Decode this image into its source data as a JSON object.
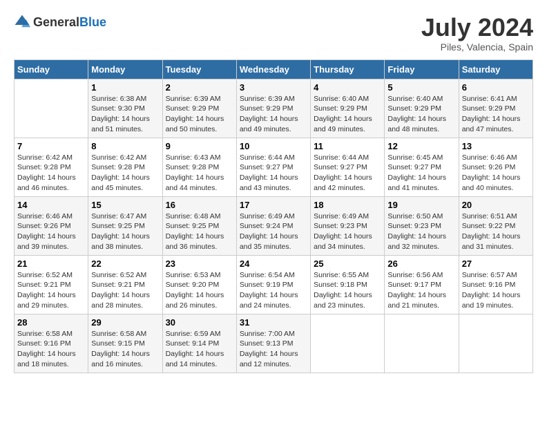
{
  "logo": {
    "general": "General",
    "blue": "Blue"
  },
  "title": "July 2024",
  "subtitle": "Piles, Valencia, Spain",
  "days_header": [
    "Sunday",
    "Monday",
    "Tuesday",
    "Wednesday",
    "Thursday",
    "Friday",
    "Saturday"
  ],
  "weeks": [
    [
      {
        "num": "",
        "info": ""
      },
      {
        "num": "1",
        "info": "Sunrise: 6:38 AM\nSunset: 9:30 PM\nDaylight: 14 hours\nand 51 minutes."
      },
      {
        "num": "2",
        "info": "Sunrise: 6:39 AM\nSunset: 9:29 PM\nDaylight: 14 hours\nand 50 minutes."
      },
      {
        "num": "3",
        "info": "Sunrise: 6:39 AM\nSunset: 9:29 PM\nDaylight: 14 hours\nand 49 minutes."
      },
      {
        "num": "4",
        "info": "Sunrise: 6:40 AM\nSunset: 9:29 PM\nDaylight: 14 hours\nand 49 minutes."
      },
      {
        "num": "5",
        "info": "Sunrise: 6:40 AM\nSunset: 9:29 PM\nDaylight: 14 hours\nand 48 minutes."
      },
      {
        "num": "6",
        "info": "Sunrise: 6:41 AM\nSunset: 9:29 PM\nDaylight: 14 hours\nand 47 minutes."
      }
    ],
    [
      {
        "num": "7",
        "info": "Sunrise: 6:42 AM\nSunset: 9:28 PM\nDaylight: 14 hours\nand 46 minutes."
      },
      {
        "num": "8",
        "info": "Sunrise: 6:42 AM\nSunset: 9:28 PM\nDaylight: 14 hours\nand 45 minutes."
      },
      {
        "num": "9",
        "info": "Sunrise: 6:43 AM\nSunset: 9:28 PM\nDaylight: 14 hours\nand 44 minutes."
      },
      {
        "num": "10",
        "info": "Sunrise: 6:44 AM\nSunset: 9:27 PM\nDaylight: 14 hours\nand 43 minutes."
      },
      {
        "num": "11",
        "info": "Sunrise: 6:44 AM\nSunset: 9:27 PM\nDaylight: 14 hours\nand 42 minutes."
      },
      {
        "num": "12",
        "info": "Sunrise: 6:45 AM\nSunset: 9:27 PM\nDaylight: 14 hours\nand 41 minutes."
      },
      {
        "num": "13",
        "info": "Sunrise: 6:46 AM\nSunset: 9:26 PM\nDaylight: 14 hours\nand 40 minutes."
      }
    ],
    [
      {
        "num": "14",
        "info": "Sunrise: 6:46 AM\nSunset: 9:26 PM\nDaylight: 14 hours\nand 39 minutes."
      },
      {
        "num": "15",
        "info": "Sunrise: 6:47 AM\nSunset: 9:25 PM\nDaylight: 14 hours\nand 38 minutes."
      },
      {
        "num": "16",
        "info": "Sunrise: 6:48 AM\nSunset: 9:25 PM\nDaylight: 14 hours\nand 36 minutes."
      },
      {
        "num": "17",
        "info": "Sunrise: 6:49 AM\nSunset: 9:24 PM\nDaylight: 14 hours\nand 35 minutes."
      },
      {
        "num": "18",
        "info": "Sunrise: 6:49 AM\nSunset: 9:23 PM\nDaylight: 14 hours\nand 34 minutes."
      },
      {
        "num": "19",
        "info": "Sunrise: 6:50 AM\nSunset: 9:23 PM\nDaylight: 14 hours\nand 32 minutes."
      },
      {
        "num": "20",
        "info": "Sunrise: 6:51 AM\nSunset: 9:22 PM\nDaylight: 14 hours\nand 31 minutes."
      }
    ],
    [
      {
        "num": "21",
        "info": "Sunrise: 6:52 AM\nSunset: 9:21 PM\nDaylight: 14 hours\nand 29 minutes."
      },
      {
        "num": "22",
        "info": "Sunrise: 6:52 AM\nSunset: 9:21 PM\nDaylight: 14 hours\nand 28 minutes."
      },
      {
        "num": "23",
        "info": "Sunrise: 6:53 AM\nSunset: 9:20 PM\nDaylight: 14 hours\nand 26 minutes."
      },
      {
        "num": "24",
        "info": "Sunrise: 6:54 AM\nSunset: 9:19 PM\nDaylight: 14 hours\nand 24 minutes."
      },
      {
        "num": "25",
        "info": "Sunrise: 6:55 AM\nSunset: 9:18 PM\nDaylight: 14 hours\nand 23 minutes."
      },
      {
        "num": "26",
        "info": "Sunrise: 6:56 AM\nSunset: 9:17 PM\nDaylight: 14 hours\nand 21 minutes."
      },
      {
        "num": "27",
        "info": "Sunrise: 6:57 AM\nSunset: 9:16 PM\nDaylight: 14 hours\nand 19 minutes."
      }
    ],
    [
      {
        "num": "28",
        "info": "Sunrise: 6:58 AM\nSunset: 9:16 PM\nDaylight: 14 hours\nand 18 minutes."
      },
      {
        "num": "29",
        "info": "Sunrise: 6:58 AM\nSunset: 9:15 PM\nDaylight: 14 hours\nand 16 minutes."
      },
      {
        "num": "30",
        "info": "Sunrise: 6:59 AM\nSunset: 9:14 PM\nDaylight: 14 hours\nand 14 minutes."
      },
      {
        "num": "31",
        "info": "Sunrise: 7:00 AM\nSunset: 9:13 PM\nDaylight: 14 hours\nand 12 minutes."
      },
      {
        "num": "",
        "info": ""
      },
      {
        "num": "",
        "info": ""
      },
      {
        "num": "",
        "info": ""
      }
    ]
  ]
}
